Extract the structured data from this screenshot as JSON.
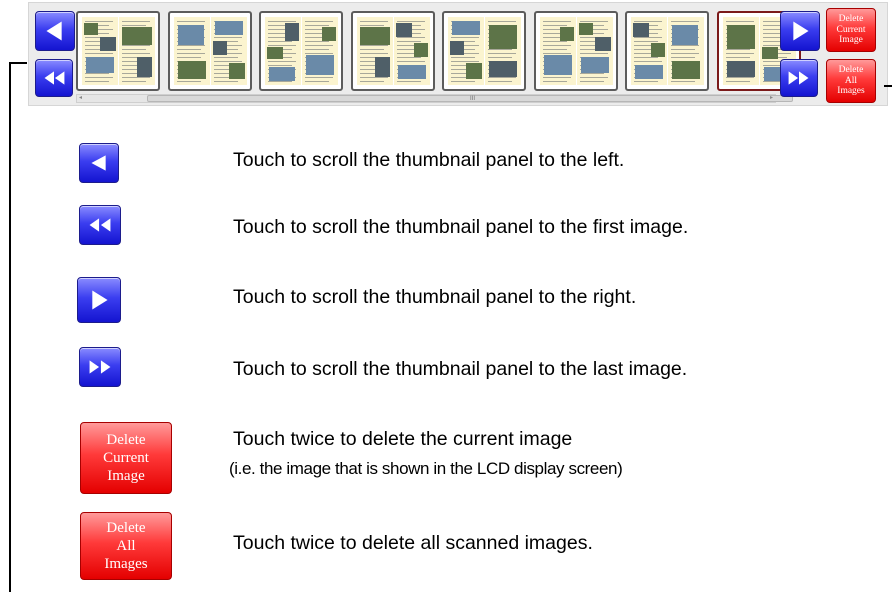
{
  "toolbar": {
    "delete_current_label": [
      "Delete",
      "Current",
      "Image"
    ],
    "delete_all_label": [
      "Delete",
      "All",
      "Images"
    ],
    "thumbnail_count": 8,
    "selected_index": 7
  },
  "legend": [
    {
      "icon": "scroll-left-icon",
      "text": "Touch to scroll the thumbnail panel to the left."
    },
    {
      "icon": "scroll-first-icon",
      "text": "Touch to scroll the thumbnail panel to the first image."
    },
    {
      "icon": "scroll-right-icon",
      "text": "Touch to scroll the thumbnail panel to the right."
    },
    {
      "icon": "scroll-last-icon",
      "text": "Touch to scroll the thumbnail panel to the last image."
    },
    {
      "icon": "delete-current-button",
      "text": "Touch twice to delete the current image",
      "subtext": "(i.e. the image that is shown in the LCD display screen)"
    },
    {
      "icon": "delete-all-button",
      "text": "Touch twice to delete all scanned images."
    }
  ],
  "colors": {
    "nav_blue": "#2a2de6",
    "delete_red": "#ff2a2a",
    "selected_border": "#7b1a1a",
    "page_bg": "#fbf4cf"
  }
}
